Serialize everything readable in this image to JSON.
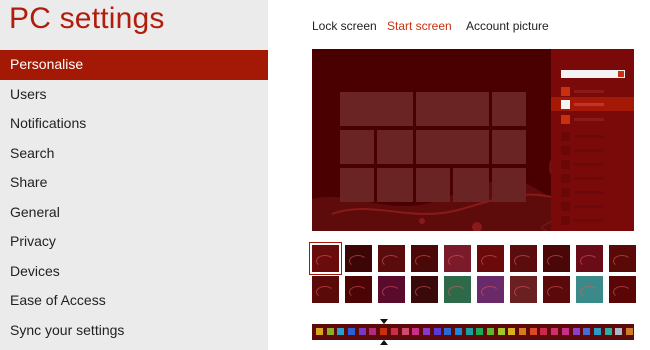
{
  "app": {
    "title": "PC settings"
  },
  "nav": {
    "items": [
      {
        "label": "Personalise",
        "selected": true
      },
      {
        "label": "Users",
        "selected": false
      },
      {
        "label": "Notifications",
        "selected": false
      },
      {
        "label": "Search",
        "selected": false
      },
      {
        "label": "Share",
        "selected": false
      },
      {
        "label": "General",
        "selected": false
      },
      {
        "label": "Privacy",
        "selected": false
      },
      {
        "label": "Devices",
        "selected": false
      },
      {
        "label": "Ease of Access",
        "selected": false
      },
      {
        "label": "Sync your settings",
        "selected": false
      }
    ]
  },
  "tabs": [
    {
      "label": "Lock screen",
      "active": false
    },
    {
      "label": "Start screen",
      "active": true
    },
    {
      "label": "Account picture",
      "active": false
    }
  ],
  "colors": {
    "accent": "#a31905",
    "title": "#b01e0b",
    "preview_bg": "#4a0000",
    "tile": "#6b2424",
    "selected_tab": "#c8300f"
  },
  "patterns": {
    "count": 20,
    "selected_index": 0,
    "fills": [
      "#6b0c0c",
      "#3c0606",
      "#5a0c0c",
      "#4a0808",
      "#7a1a2a",
      "#6a0a0a",
      "#5b0d0d",
      "#4a0707",
      "#6a0c18",
      "#5a0909",
      "#5b0a0a",
      "#4c0404",
      "#5a0a2a",
      "#3a0909",
      "#2e6a4a",
      "#6a2a6a",
      "#6a2020",
      "#5a0a0a",
      "#3a8a8a",
      "#5a0606"
    ]
  },
  "accent_colors": {
    "selected_index": 6,
    "swatches": [
      "#d9a520",
      "#8aae2a",
      "#2aa0c8",
      "#2b5fd6",
      "#7a3ac0",
      "#b02a80",
      "#c8300f",
      "#c8304a",
      "#d04a70",
      "#c83088",
      "#8a3ac8",
      "#5a3ad6",
      "#2a6ad6",
      "#1a8ad6",
      "#1aa0a0",
      "#1aaa5a",
      "#5aba2a",
      "#a0c82a",
      "#d8b020",
      "#d87a20",
      "#d84a2a",
      "#c82a4a",
      "#d0306a",
      "#c8308a",
      "#8a40c8",
      "#4a6ad6",
      "#2a9ac8",
      "#2ab0a0",
      "#aab8c8",
      "#d07a2a"
    ]
  }
}
